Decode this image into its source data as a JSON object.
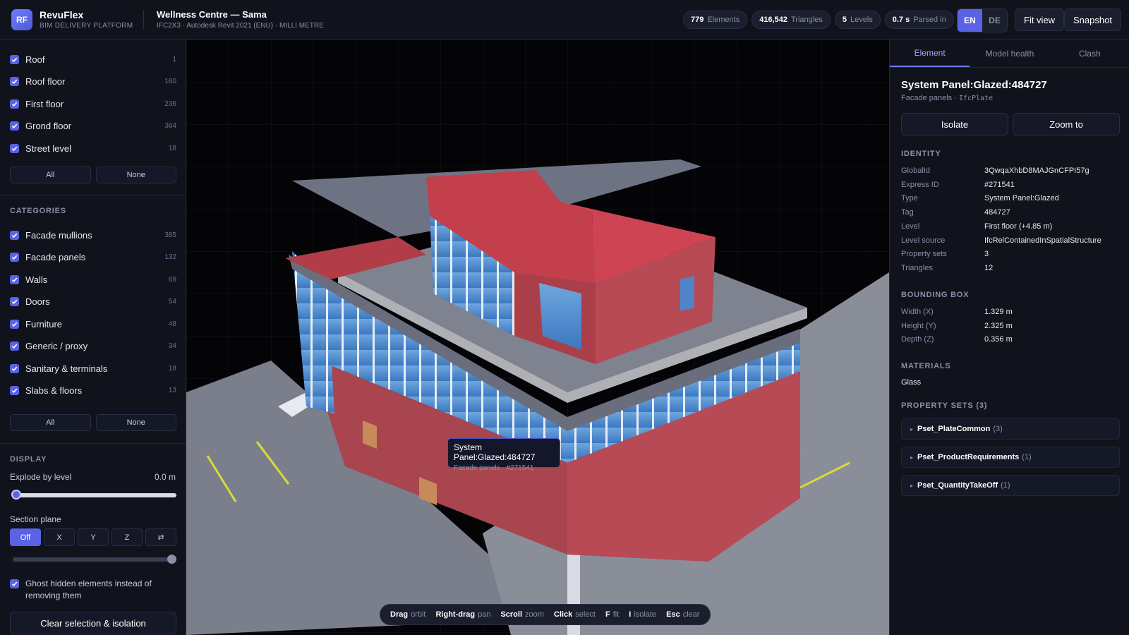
{
  "app": {
    "logo": "RF",
    "name": "RevuFlex",
    "subtitle": "BIM DELIVERY PLATFORM"
  },
  "project": {
    "title": "Wellness Centre — Sama",
    "meta": "IFC2X3 · Autodesk Revit 2021 (ENU) · MILLI METRE"
  },
  "stats": [
    {
      "value": "779",
      "label": "Elements"
    },
    {
      "value": "416,542",
      "label": "Triangles"
    },
    {
      "value": "5",
      "label": "Levels"
    },
    {
      "value": "0.7 s",
      "label": "Parsed in"
    }
  ],
  "lang": {
    "en": "EN",
    "de": "DE",
    "active": "EN"
  },
  "toolbar": {
    "fit_view": "Fit view",
    "snapshot": "Snapshot"
  },
  "levels": [
    {
      "label": "Roof",
      "count": "1"
    },
    {
      "label": "Roof floor",
      "count": "160"
    },
    {
      "label": "First floor",
      "count": "236"
    },
    {
      "label": "Grond floor",
      "count": "364"
    },
    {
      "label": "Street level",
      "count": "18"
    }
  ],
  "buttons": {
    "all": "All",
    "none": "None"
  },
  "categories_header": "CATEGORIES",
  "categories": [
    {
      "label": "Facade mullions",
      "count": "385"
    },
    {
      "label": "Facade panels",
      "count": "132"
    },
    {
      "label": "Walls",
      "count": "69"
    },
    {
      "label": "Doors",
      "count": "54"
    },
    {
      "label": "Furniture",
      "count": "48"
    },
    {
      "label": "Generic / proxy",
      "count": "34"
    },
    {
      "label": "Sanitary & terminals",
      "count": "18"
    },
    {
      "label": "Slabs & floors",
      "count": "13"
    }
  ],
  "display": {
    "header": "DISPLAY",
    "explode_label": "Explode by level",
    "explode_value": "0.0 m",
    "explode_fraction": 0,
    "section_label": "Section plane",
    "section_options": [
      "Off",
      "X",
      "Y",
      "Z",
      "⇄"
    ],
    "section_active": "Off",
    "section_fraction": 1,
    "ghost_label": "Ghost hidden elements instead of removing them",
    "clear_button": "Clear selection & isolation"
  },
  "tooltip": {
    "title": "System Panel:Glazed:484727",
    "sub": "Facade panels · #271541"
  },
  "hints": [
    {
      "key": "Drag",
      "desc": "orbit"
    },
    {
      "key": "Right-drag",
      "desc": "pan"
    },
    {
      "key": "Scroll",
      "desc": "zoom"
    },
    {
      "key": "Click",
      "desc": "select"
    },
    {
      "key": "F",
      "desc": "fit"
    },
    {
      "key": "I",
      "desc": "isolate"
    },
    {
      "key": "Esc",
      "desc": "clear"
    }
  ],
  "tabs": [
    "Element",
    "Model health",
    "Clash"
  ],
  "element": {
    "title": "System Panel:Glazed:484727",
    "category": "Facade panels",
    "ifc_class": "IfcPlate",
    "isolate": "Isolate",
    "zoom_to": "Zoom to",
    "identity_header": "IDENTITY",
    "identity": [
      {
        "k": "GlobalId",
        "v": "3QwqaXhbD8MAJGnCFPI57g"
      },
      {
        "k": "Express ID",
        "v": "#271541"
      },
      {
        "k": "Type",
        "v": "System Panel:Glazed"
      },
      {
        "k": "Tag",
        "v": "484727"
      },
      {
        "k": "Level",
        "v": "First floor (+4.85 m)"
      },
      {
        "k": "Level source",
        "v": "IfcRelContainedInSpatialStructure"
      },
      {
        "k": "Property sets",
        "v": "3"
      },
      {
        "k": "Triangles",
        "v": "12"
      }
    ],
    "bbox_header": "BOUNDING BOX",
    "bbox": [
      {
        "k": "Width (X)",
        "v": "1.329 m"
      },
      {
        "k": "Height (Y)",
        "v": "2.325 m"
      },
      {
        "k": "Depth (Z)",
        "v": "0.356 m"
      }
    ],
    "materials_header": "MATERIALS",
    "material": "Glass",
    "psets_header": "PROPERTY SETS (3)",
    "psets": [
      {
        "name": "Pset_PlateCommon",
        "count": "(3)"
      },
      {
        "name": "Pset_ProductRequirements",
        "count": "(1)"
      },
      {
        "name": "Pset_QuantityTakeOff",
        "count": "(1)"
      }
    ]
  }
}
